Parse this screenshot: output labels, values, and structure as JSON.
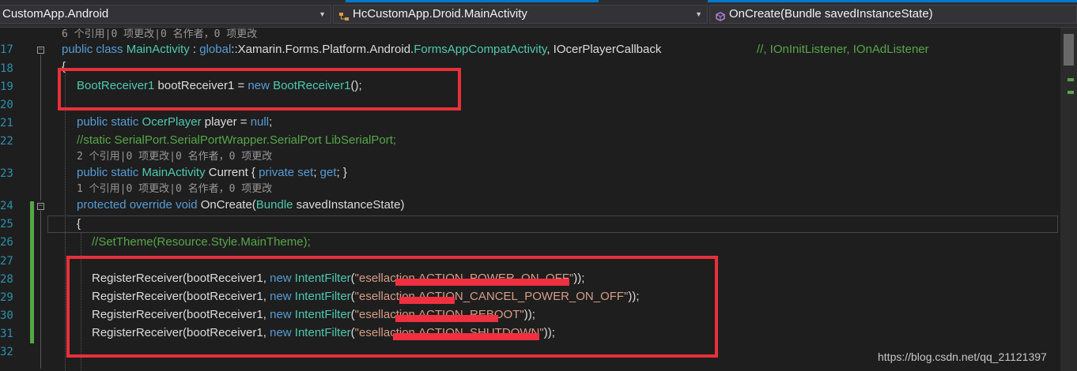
{
  "navbar": {
    "project_dropdown": "CustomApp.Android",
    "class_dropdown": "HcCustomApp.Droid.MainActivity",
    "member_dropdown": "OnCreate(Bundle savedInstanceState)"
  },
  "editor": {
    "line_numbers": [
      "17",
      "18",
      "19",
      "20",
      "21",
      "22",
      "23",
      "24",
      "25",
      "26",
      "27",
      "28",
      "29",
      "30",
      "31",
      "32"
    ],
    "codelens": {
      "lens1": "6 个引用|0 项更改|0 名作者，0 项更改",
      "lens2": "2 个引用|0 项更改|0 名作者，0 项更改",
      "lens3": "1 个引用|0 项更改|0 名作者，0 项更改"
    },
    "lines": {
      "l17": {
        "k1": "public class ",
        "t1": "MainActivity",
        "p1": " : ",
        "k2": "global",
        "p2": "::Xamarin.Forms.Platform.Android.",
        "t2": "FormsAppCompatActivity",
        "p3": ", IOcerPlayerCallback",
        "c1": "//, IOnInitListener, IOnAdListener"
      },
      "l18": "{",
      "l19": {
        "t1": "BootReceiver1",
        "p1": " bootReceiver1 = ",
        "k1": "new ",
        "t2": "BootReceiver1",
        "p2": "();"
      },
      "l21": {
        "k1": "public static ",
        "t1": "OcerPlayer",
        "p1": " player = ",
        "k2": "null",
        "p2": ";"
      },
      "l22": "//static SerialPort.SerialPortWrapper.SerialPort LibSerialPort;",
      "l23": {
        "k1": "public static ",
        "t1": "MainActivity",
        "p1": " Current { ",
        "k2": "private set",
        "p2": "; ",
        "k3": "get",
        "p3": "; }"
      },
      "l24": {
        "k1": "protected override void ",
        "p1": "OnCreate(",
        "t1": "Bundle",
        "p2": " savedInstanceState)"
      },
      "l25": "{",
      "l26": "//SetTheme(Resource.Style.MainTheme);",
      "l28": {
        "p1": "RegisterReceiver(bootReceiver1, ",
        "k1": "new ",
        "t1": "IntentFilter",
        "p2": "(",
        "s1": "\"esellaction.ACTION_POWER_ON_OFF\"",
        "p3": "));"
      },
      "l29": {
        "p1": "RegisterReceiver(bootReceiver1, ",
        "k1": "new ",
        "t1": "IntentFilter",
        "p2": "(",
        "s1": "\"esellaction.ACTION_CANCEL_POWER_ON_OFF\"",
        "p3": "));"
      },
      "l30": {
        "p1": "RegisterReceiver(bootReceiver1, ",
        "k1": "new ",
        "t1": "IntentFilter",
        "p2": "(",
        "s1": "\"esellaction.ACTION_REBOOT\"",
        "p3": "));"
      },
      "l31": {
        "p1": "RegisterReceiver(bootReceiver1, ",
        "k1": "new ",
        "t1": "IntentFilter",
        "p2": "(",
        "s1": "\"esellaction.ACTION_SHUTDOWN\"",
        "p3": "));"
      }
    }
  },
  "watermark": "https://blog.csdn.net/qq_21121397",
  "colors": {
    "keyword": "#569cd6",
    "type": "#4ec9b0",
    "comment": "#57a64a",
    "string": "#d69d85",
    "highlight_box": "#e8303a",
    "line_number": "#2b91af"
  },
  "icons": [
    "chevron-down-icon",
    "class-icon",
    "method-icon"
  ]
}
